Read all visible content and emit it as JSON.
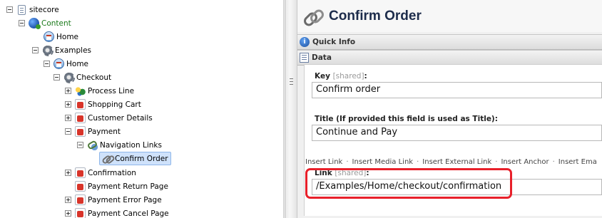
{
  "tree": {
    "items": [
      {
        "label": "sitecore",
        "toggle": "minus",
        "icon": "document-icon"
      },
      {
        "label": "Content",
        "toggle": "minus",
        "icon": "content-icon"
      },
      {
        "label": "Home",
        "toggle": "none",
        "icon": "home-icon"
      },
      {
        "label": "Examples",
        "toggle": "minus",
        "icon": "gear-folder-icon"
      },
      {
        "label": "Home",
        "toggle": "minus",
        "icon": "home-icon"
      },
      {
        "label": "Checkout",
        "toggle": "minus",
        "icon": "gear-folder-icon"
      },
      {
        "label": "Process Line",
        "toggle": "plus",
        "icon": "process-icon"
      },
      {
        "label": "Shopping Cart",
        "toggle": "plus",
        "icon": "page-icon"
      },
      {
        "label": "Customer Details",
        "toggle": "plus",
        "icon": "page-icon"
      },
      {
        "label": "Payment",
        "toggle": "minus",
        "icon": "page-icon"
      },
      {
        "label": "Navigation Links",
        "toggle": "minus",
        "icon": "navigation-links-icon"
      },
      {
        "label": "Confirm Order",
        "toggle": "none",
        "icon": "link-icon",
        "selected": true
      },
      {
        "label": "Confirmation",
        "toggle": "plus",
        "icon": "page-icon"
      },
      {
        "label": "Payment Return Page",
        "toggle": "none",
        "icon": "page-icon"
      },
      {
        "label": "Payment Error Page",
        "toggle": "plus",
        "icon": "page-icon"
      },
      {
        "label": "Payment Cancel Page",
        "toggle": "plus",
        "icon": "page-icon"
      }
    ]
  },
  "editor": {
    "title": "Confirm Order",
    "sections": {
      "quick_info": "Quick Info",
      "data": "Data"
    },
    "fields": {
      "key": {
        "label": "Key",
        "shared": "[shared]",
        "colon": ":",
        "value": "Confirm order"
      },
      "title": {
        "label": "Title (If provided this field is used as Title):",
        "value": "Continue and Pay"
      },
      "link": {
        "label": "Link",
        "shared": "[shared]",
        "colon": ":",
        "value": "/Examples/Home/checkout/confirmation"
      }
    },
    "link_tools": [
      "Insert Link",
      "Insert Media Link",
      "Insert External Link",
      "Insert Anchor",
      "Insert Ema"
    ],
    "separator": "·"
  },
  "colors": {
    "highlight": "#e8202a",
    "title": "#1d2c4b",
    "content_label": "#1a7a1a",
    "selected_background": "#cfe2fb"
  }
}
